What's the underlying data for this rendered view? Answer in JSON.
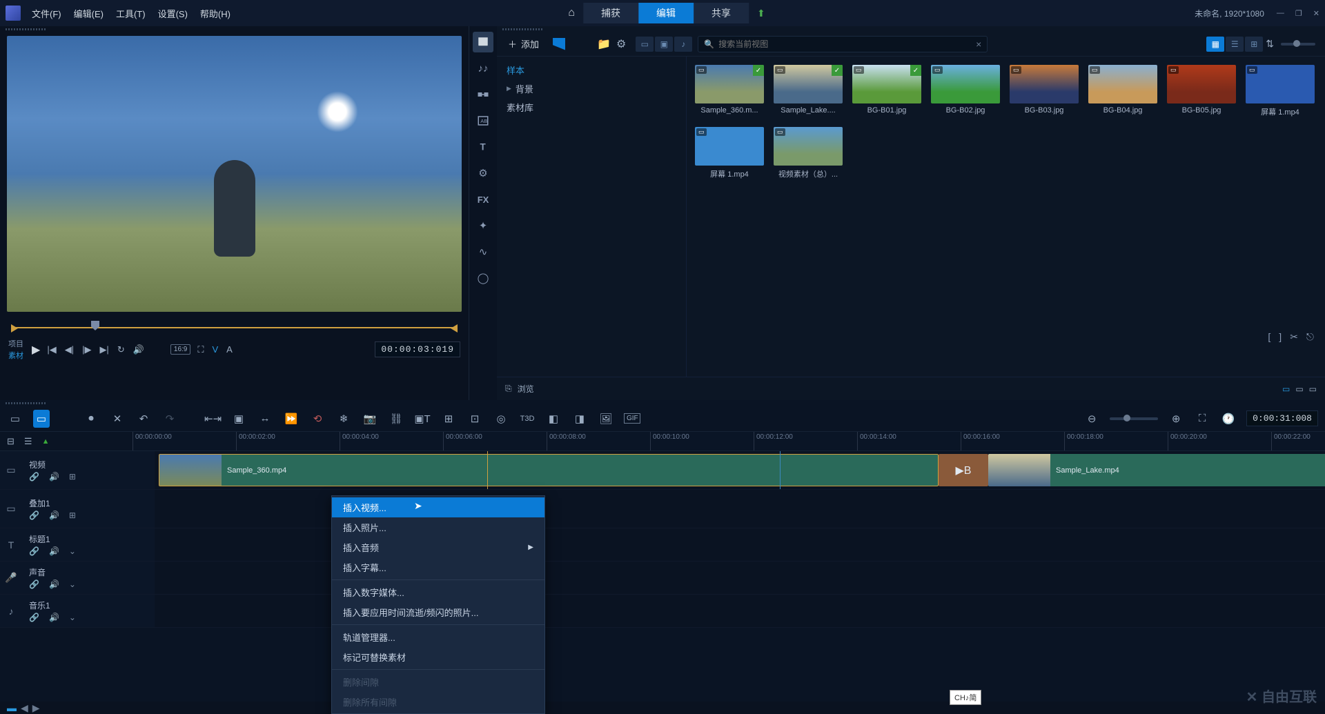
{
  "menubar": {
    "items": [
      "文件(F)",
      "编辑(E)",
      "工具(T)",
      "设置(S)",
      "帮助(H)"
    ],
    "tabs": {
      "capture": "捕获",
      "edit": "编辑",
      "share": "共享"
    },
    "project_label": "未命名, 1920*1080"
  },
  "preview": {
    "tabs": {
      "project": "项目",
      "clip": "素材"
    },
    "timecode": "00:00:03:019",
    "aspect": "16:9",
    "va": {
      "v": "V",
      "a": "A"
    }
  },
  "library": {
    "add": "添加",
    "tree": {
      "sample": "样本",
      "background": "背景",
      "media_lib": "素材库"
    },
    "search_placeholder": "搜索当前视图",
    "browse": "浏览",
    "thumbs": [
      {
        "label": "Sample_360.m...",
        "selected": true,
        "bg": "linear-gradient(180deg,#4a7ab0 0%,#8a9a6a 70%)"
      },
      {
        "label": "Sample_Lake....",
        "selected": true,
        "bg": "linear-gradient(180deg,#d0c8a0 0%,#4a6a8a 70%)"
      },
      {
        "label": "BG-B01.jpg",
        "selected": true,
        "bg": "linear-gradient(180deg,#c8e0f0 0%,#5a9a3a 70%)"
      },
      {
        "label": "BG-B02.jpg",
        "selected": false,
        "bg": "linear-gradient(180deg,#6ab0e0 0%,#3a9a3a 70%)"
      },
      {
        "label": "BG-B03.jpg",
        "selected": false,
        "bg": "linear-gradient(180deg,#c87a3a 0%,#2a3a6a 70%)"
      },
      {
        "label": "BG-B04.jpg",
        "selected": false,
        "bg": "linear-gradient(180deg,#8ab0d0 0%,#c89a5a 70%)"
      },
      {
        "label": "BG-B05.jpg",
        "selected": false,
        "bg": "linear-gradient(180deg,#b03a1a 0%,#7a2a1a 70%)"
      },
      {
        "label": "屏幕 1.mp4",
        "selected": false,
        "bg": "linear-gradient(180deg,#2a5ab0 0%,#2a5ab0 70%)"
      },
      {
        "label": "屏幕 1.mp4",
        "selected": false,
        "bg": "linear-gradient(180deg,#3a8ad0 0%,#3a8ad0 70%)"
      },
      {
        "label": "视频素材（总）...",
        "selected": false,
        "bg": "linear-gradient(180deg,#5a9ad0 0%,#7a9a6a 70%)"
      }
    ]
  },
  "timeline": {
    "timecode": "0:00:31:008",
    "ruler": [
      "00:00:00:00",
      "00:00:02:00",
      "00:00:04:00",
      "00:00:06:00",
      "00:00:08:00",
      "00:00:10:00",
      "00:00:12:00",
      "00:00:14:00",
      "00:00:16:00",
      "00:00:18:00",
      "00:00:20:00",
      "00:00:22:00"
    ],
    "tracks": {
      "video": "视频",
      "overlay1": "叠加1",
      "title1": "标题1",
      "voice": "声音",
      "music1": "音乐1"
    },
    "clips": {
      "c1": "Sample_360.mp4",
      "c2": "Sample_Lake.mp4"
    }
  },
  "context_menu": {
    "insert_video": "插入视频...",
    "insert_photo": "插入照片...",
    "insert_audio": "插入音频",
    "insert_subtitle": "插入字幕...",
    "insert_digital": "插入数字媒体...",
    "insert_timelapse": "插入要应用时间流逝/频闪的照片...",
    "track_manager": "轨道管理器...",
    "mark_replaceable": "标记可替换素材",
    "delete_gap": "删除间隙",
    "delete_all_gaps": "删除所有间隙"
  },
  "tooltip": "CH♪简",
  "watermark": "自由互联"
}
